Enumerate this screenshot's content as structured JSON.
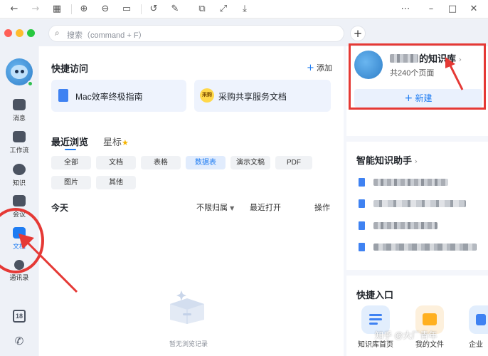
{
  "search": {
    "placeholder": "搜索（command + F）"
  },
  "sidebar": {
    "items": [
      {
        "label": "消息"
      },
      {
        "label": "工作流"
      },
      {
        "label": "知识"
      },
      {
        "label": "会议"
      },
      {
        "label": "文档"
      },
      {
        "label": "通讯录"
      }
    ],
    "active": "文档",
    "calendar_day": "18"
  },
  "main": {
    "quick_access": {
      "title": "快捷访问",
      "add_label": "添加",
      "cards": [
        {
          "label": "Mac效率终极指南",
          "icon": "doc-icon"
        },
        {
          "label": "采购共享服务文档",
          "icon": "procurement-badge-icon",
          "badge": "采购"
        }
      ]
    },
    "tabs": [
      {
        "label": "最近浏览",
        "active": true
      },
      {
        "label": "星标"
      }
    ],
    "filters": [
      "全部",
      "文档",
      "表格",
      "数据表",
      "演示文稿",
      "PDF",
      "图片",
      "其他"
    ],
    "active_filter": "数据表",
    "list_header": {
      "group": "今天",
      "owner_filter": "不限归属",
      "sort": "最近打开",
      "action": "操作"
    },
    "empty_text": "暂无浏览记录"
  },
  "right": {
    "kb": {
      "title_suffix": "的知识库",
      "count": "共240个页面",
      "new_label": "新建"
    },
    "assistant_title": "智能知识助手",
    "quick_entry_title": "快捷入口",
    "entries": [
      {
        "label": "知识库首页"
      },
      {
        "label": "我的文件"
      },
      {
        "label": "企业"
      }
    ]
  },
  "watermark": "知乎 @大厂青年",
  "colors": {
    "accent": "#1e7cf2",
    "annotation": "#e53935"
  }
}
